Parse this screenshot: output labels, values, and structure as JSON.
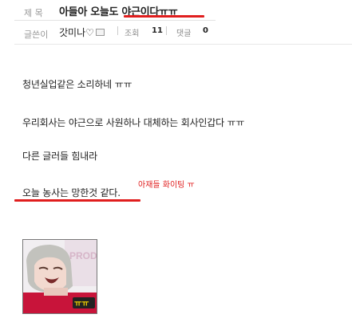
{
  "header": {
    "title_label": "제 목",
    "title_text": "아들아 오늘도 ",
    "title_highlight": "야근이다ㅠㅠ",
    "author_label": "글쓴이",
    "author": "갓미나♡",
    "views_label": "조회",
    "views": "11",
    "comments_label": "댓글",
    "comments": "0"
  },
  "body": {
    "lines": [
      "청년실업같은 소리하네 ㅠㅠ",
      "우리회사는 야근으로 사원하나 대체하는 회사인갑다 ㅠㅠ",
      "다른 글러들 힘내라",
      "오늘 농사는 망한것 같다."
    ],
    "annotation": "아재들 화이팅 ㅠ"
  },
  "image": {
    "description": "crying-person-meme",
    "caption": "ㅠㅠ",
    "background_text": "PROD"
  },
  "colors": {
    "accent": "#e01e1e",
    "label": "#999999"
  }
}
